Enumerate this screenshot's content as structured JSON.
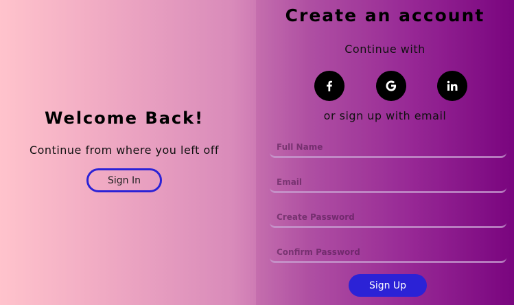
{
  "welcome": {
    "title": "Welcome Back!",
    "subtitle": "Continue from where you left off",
    "signin_label": "Sign In"
  },
  "signup": {
    "title": "Create an account",
    "continue_with": "Continue with",
    "social": [
      {
        "name": "facebook-icon"
      },
      {
        "name": "google-icon"
      },
      {
        "name": "linkedin-icon"
      }
    ],
    "or_email": "or sign up with email",
    "fields": {
      "full_name": {
        "value": "",
        "placeholder": "Full Name"
      },
      "email": {
        "value": "",
        "placeholder": "Email"
      },
      "create_password": {
        "value": "",
        "placeholder": "Create Password"
      },
      "confirm_password": {
        "value": "",
        "placeholder": "Confirm Password"
      }
    },
    "signup_label": "Sign Up"
  },
  "colors": {
    "accent": "#2b22d6",
    "gradient_start": "#ffc3cc",
    "gradient_end": "#7a0680"
  }
}
